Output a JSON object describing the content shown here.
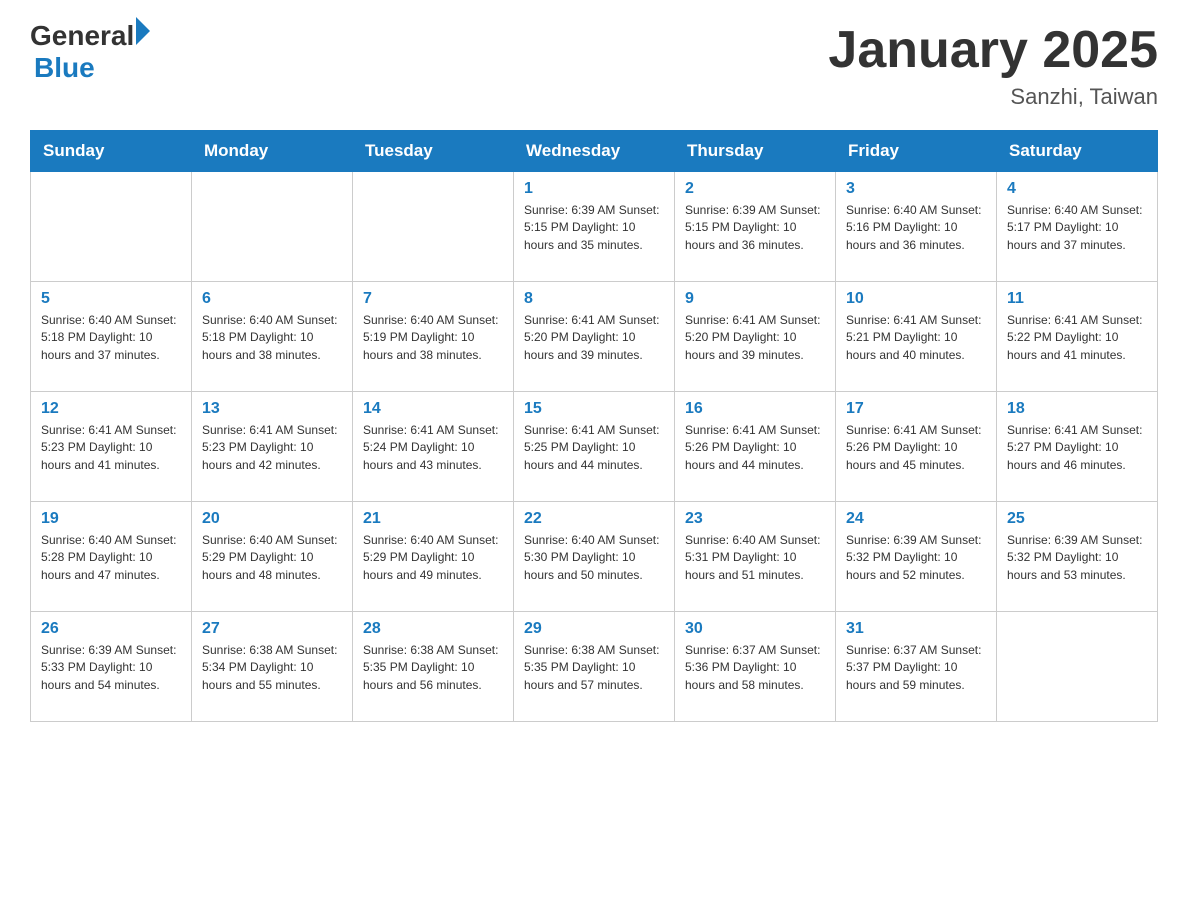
{
  "header": {
    "logo_general": "General",
    "logo_blue": "Blue",
    "title": "January 2025",
    "subtitle": "Sanzhi, Taiwan"
  },
  "days_of_week": [
    "Sunday",
    "Monday",
    "Tuesday",
    "Wednesday",
    "Thursday",
    "Friday",
    "Saturday"
  ],
  "weeks": [
    {
      "days": [
        {
          "number": "",
          "info": ""
        },
        {
          "number": "",
          "info": ""
        },
        {
          "number": "",
          "info": ""
        },
        {
          "number": "1",
          "info": "Sunrise: 6:39 AM\nSunset: 5:15 PM\nDaylight: 10 hours\nand 35 minutes."
        },
        {
          "number": "2",
          "info": "Sunrise: 6:39 AM\nSunset: 5:15 PM\nDaylight: 10 hours\nand 36 minutes."
        },
        {
          "number": "3",
          "info": "Sunrise: 6:40 AM\nSunset: 5:16 PM\nDaylight: 10 hours\nand 36 minutes."
        },
        {
          "number": "4",
          "info": "Sunrise: 6:40 AM\nSunset: 5:17 PM\nDaylight: 10 hours\nand 37 minutes."
        }
      ]
    },
    {
      "days": [
        {
          "number": "5",
          "info": "Sunrise: 6:40 AM\nSunset: 5:18 PM\nDaylight: 10 hours\nand 37 minutes."
        },
        {
          "number": "6",
          "info": "Sunrise: 6:40 AM\nSunset: 5:18 PM\nDaylight: 10 hours\nand 38 minutes."
        },
        {
          "number": "7",
          "info": "Sunrise: 6:40 AM\nSunset: 5:19 PM\nDaylight: 10 hours\nand 38 minutes."
        },
        {
          "number": "8",
          "info": "Sunrise: 6:41 AM\nSunset: 5:20 PM\nDaylight: 10 hours\nand 39 minutes."
        },
        {
          "number": "9",
          "info": "Sunrise: 6:41 AM\nSunset: 5:20 PM\nDaylight: 10 hours\nand 39 minutes."
        },
        {
          "number": "10",
          "info": "Sunrise: 6:41 AM\nSunset: 5:21 PM\nDaylight: 10 hours\nand 40 minutes."
        },
        {
          "number": "11",
          "info": "Sunrise: 6:41 AM\nSunset: 5:22 PM\nDaylight: 10 hours\nand 41 minutes."
        }
      ]
    },
    {
      "days": [
        {
          "number": "12",
          "info": "Sunrise: 6:41 AM\nSunset: 5:23 PM\nDaylight: 10 hours\nand 41 minutes."
        },
        {
          "number": "13",
          "info": "Sunrise: 6:41 AM\nSunset: 5:23 PM\nDaylight: 10 hours\nand 42 minutes."
        },
        {
          "number": "14",
          "info": "Sunrise: 6:41 AM\nSunset: 5:24 PM\nDaylight: 10 hours\nand 43 minutes."
        },
        {
          "number": "15",
          "info": "Sunrise: 6:41 AM\nSunset: 5:25 PM\nDaylight: 10 hours\nand 44 minutes."
        },
        {
          "number": "16",
          "info": "Sunrise: 6:41 AM\nSunset: 5:26 PM\nDaylight: 10 hours\nand 44 minutes."
        },
        {
          "number": "17",
          "info": "Sunrise: 6:41 AM\nSunset: 5:26 PM\nDaylight: 10 hours\nand 45 minutes."
        },
        {
          "number": "18",
          "info": "Sunrise: 6:41 AM\nSunset: 5:27 PM\nDaylight: 10 hours\nand 46 minutes."
        }
      ]
    },
    {
      "days": [
        {
          "number": "19",
          "info": "Sunrise: 6:40 AM\nSunset: 5:28 PM\nDaylight: 10 hours\nand 47 minutes."
        },
        {
          "number": "20",
          "info": "Sunrise: 6:40 AM\nSunset: 5:29 PM\nDaylight: 10 hours\nand 48 minutes."
        },
        {
          "number": "21",
          "info": "Sunrise: 6:40 AM\nSunset: 5:29 PM\nDaylight: 10 hours\nand 49 minutes."
        },
        {
          "number": "22",
          "info": "Sunrise: 6:40 AM\nSunset: 5:30 PM\nDaylight: 10 hours\nand 50 minutes."
        },
        {
          "number": "23",
          "info": "Sunrise: 6:40 AM\nSunset: 5:31 PM\nDaylight: 10 hours\nand 51 minutes."
        },
        {
          "number": "24",
          "info": "Sunrise: 6:39 AM\nSunset: 5:32 PM\nDaylight: 10 hours\nand 52 minutes."
        },
        {
          "number": "25",
          "info": "Sunrise: 6:39 AM\nSunset: 5:32 PM\nDaylight: 10 hours\nand 53 minutes."
        }
      ]
    },
    {
      "days": [
        {
          "number": "26",
          "info": "Sunrise: 6:39 AM\nSunset: 5:33 PM\nDaylight: 10 hours\nand 54 minutes."
        },
        {
          "number": "27",
          "info": "Sunrise: 6:38 AM\nSunset: 5:34 PM\nDaylight: 10 hours\nand 55 minutes."
        },
        {
          "number": "28",
          "info": "Sunrise: 6:38 AM\nSunset: 5:35 PM\nDaylight: 10 hours\nand 56 minutes."
        },
        {
          "number": "29",
          "info": "Sunrise: 6:38 AM\nSunset: 5:35 PM\nDaylight: 10 hours\nand 57 minutes."
        },
        {
          "number": "30",
          "info": "Sunrise: 6:37 AM\nSunset: 5:36 PM\nDaylight: 10 hours\nand 58 minutes."
        },
        {
          "number": "31",
          "info": "Sunrise: 6:37 AM\nSunset: 5:37 PM\nDaylight: 10 hours\nand 59 minutes."
        },
        {
          "number": "",
          "info": ""
        }
      ]
    }
  ]
}
